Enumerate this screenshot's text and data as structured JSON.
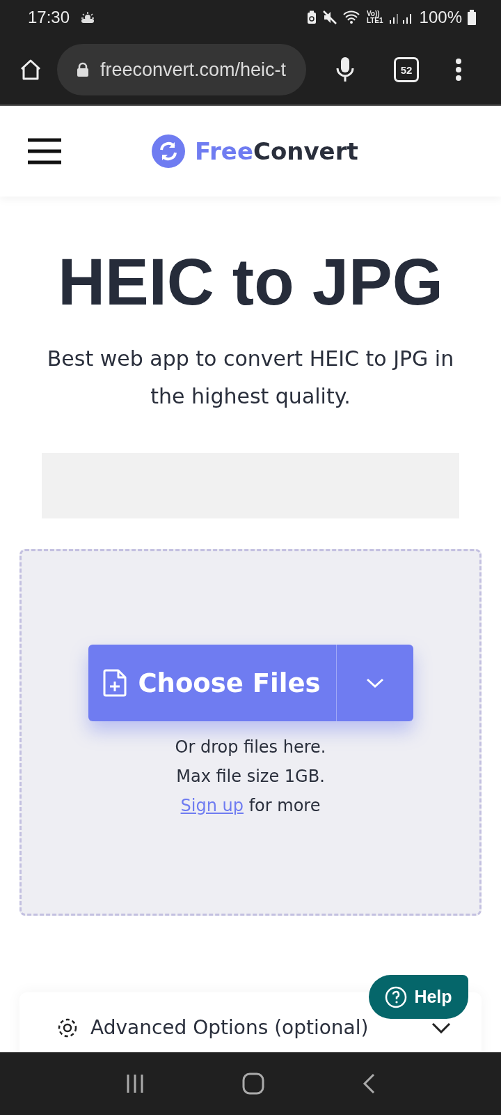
{
  "status_bar": {
    "time": "17:30",
    "network": "Vo))\nLTE1",
    "battery": "100%"
  },
  "browser": {
    "url": "freeconvert.com/heic-t",
    "tab_count": "52"
  },
  "header": {
    "logo_part1": "Free",
    "logo_part2": "Convert"
  },
  "hero": {
    "title": "HEIC to JPG",
    "subtitle": "Best web app to convert HEIC to JPG in the highest quality."
  },
  "upload": {
    "button": "Choose Files",
    "hint_lines": [
      "Or drop files here.",
      "Max file size 1GB."
    ],
    "signup_link": "Sign up",
    "signup_rest": "for more"
  },
  "help_button": "Help",
  "advanced_options": {
    "label": "Advanced Options (optional)",
    "expanded": false
  }
}
